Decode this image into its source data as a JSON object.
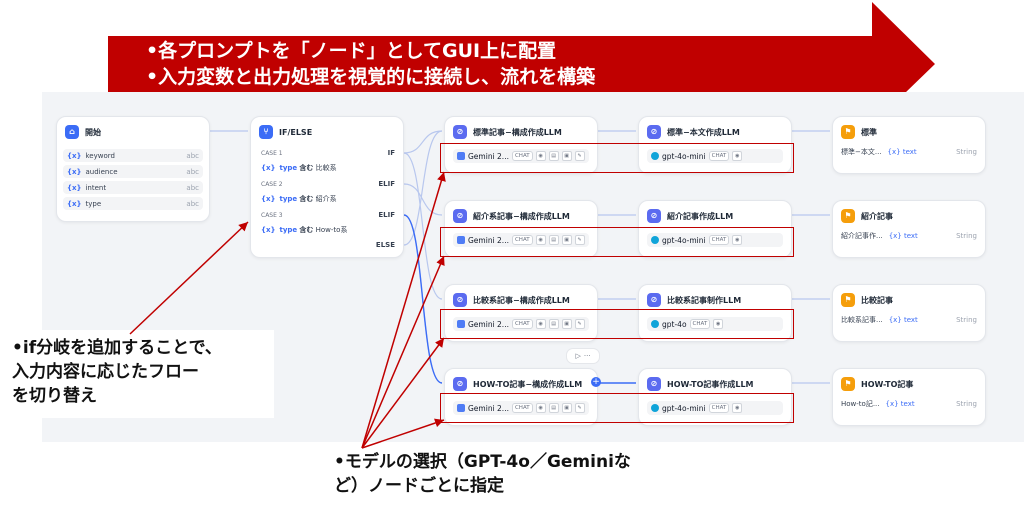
{
  "banner": {
    "line1": "•各プロンプトを「ノード」としてGUI上に配置",
    "line2": "•入力変数と出力処理を視覚的に接続し、流れを構築"
  },
  "start": {
    "title": "開始",
    "vars": [
      {
        "name": "keyword",
        "type": "abc"
      },
      {
        "name": "audience",
        "type": "abc"
      },
      {
        "name": "intent",
        "type": "abc"
      },
      {
        "name": "type",
        "type": "abc"
      }
    ]
  },
  "ifelse": {
    "title": "IF/ELSE",
    "cases": [
      {
        "label": "CASE 1",
        "kw": "IF",
        "var": "type",
        "op": "含む",
        "val": "比較系"
      },
      {
        "label": "CASE 2",
        "kw": "ELIF",
        "var": "type",
        "op": "含む",
        "val": "紹介系"
      },
      {
        "label": "CASE 3",
        "kw": "ELIF",
        "var": "type",
        "op": "含む",
        "val": "How-to系"
      }
    ],
    "else": "ELSE"
  },
  "llm1": [
    {
      "title": "標準記事−構成作成LLM",
      "model": "Gemini 2...",
      "tag": "CHAT"
    },
    {
      "title": "紹介系記事−構成作成LLM",
      "model": "Gemini 2...",
      "tag": "CHAT"
    },
    {
      "title": "比較系記事−構成作成LLM",
      "model": "Gemini 2...",
      "tag": "CHAT"
    },
    {
      "title": "HOW-TO記事−構成作成LLM",
      "model": "Gemini 2...",
      "tag": "CHAT"
    }
  ],
  "llm2": [
    {
      "title": "標準−本文作成LLM",
      "model": "gpt-4o-mini",
      "tag": "CHAT"
    },
    {
      "title": "紹介記事作成LLM",
      "model": "gpt-4o-mini",
      "tag": "CHAT"
    },
    {
      "title": "比較系記事制作LLM",
      "model": "gpt-4o",
      "tag": "CHAT"
    },
    {
      "title": "HOW-TO記事作成LLM",
      "model": "gpt-4o-mini",
      "tag": "CHAT"
    }
  ],
  "ends": [
    {
      "title": "標準",
      "src": "標準−本文...",
      "var": "text",
      "type": "String"
    },
    {
      "title": "紹介記事",
      "src": "紹介記事作...",
      "var": "text",
      "type": "String"
    },
    {
      "title": "比較記事",
      "src": "比較系記事...",
      "var": "text",
      "type": "String"
    },
    {
      "title": "HOW-TO記事",
      "src": "How-to記...",
      "var": "text",
      "type": "String"
    }
  ],
  "callout_if": {
    "line1": "•if分岐を追加することで、",
    "line2": "入力内容に応じたフロー",
    "line3": "を切り替え"
  },
  "callout_model": {
    "line1": "•モデルの選択（GPT-4o／Geminiな",
    "line2": "ど）ノードごとに指定"
  },
  "colors": {
    "banner": "#c00000",
    "accent": "#3b6cf6",
    "box": "#c00000"
  }
}
